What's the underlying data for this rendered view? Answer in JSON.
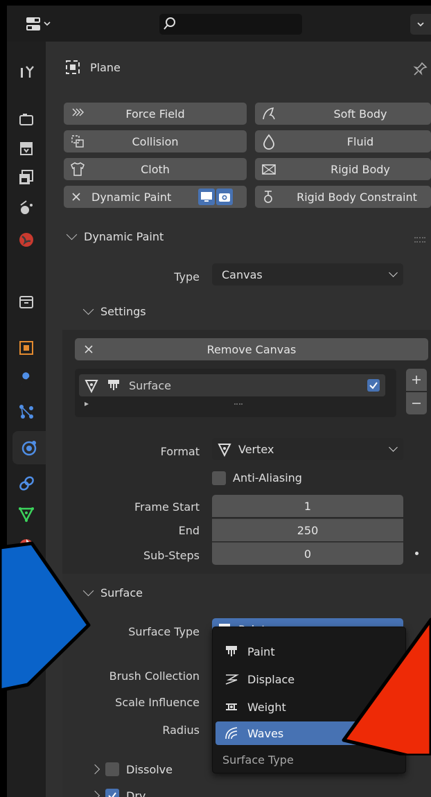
{
  "topbar": {
    "search_placeholder": ""
  },
  "object": {
    "name": "Plane"
  },
  "physics_buttons": {
    "force_field": "Force Field",
    "soft_body": "Soft Body",
    "collision": "Collision",
    "fluid": "Fluid",
    "cloth": "Cloth",
    "rigid_body": "Rigid Body",
    "dynamic_paint": "Dynamic Paint",
    "rigid_body_constraint": "Rigid Body Constraint"
  },
  "dynamic_paint": {
    "header": "Dynamic Paint",
    "type_label": "Type",
    "type_value": "Canvas",
    "settings_header": "Settings",
    "remove_canvas": "Remove Canvas",
    "surface_list_item": "Surface",
    "surface_enabled": true
  },
  "format": {
    "format_label": "Format",
    "format_value": "Vertex",
    "anti_aliasing": "Anti-Aliasing",
    "frame_start_label": "Frame Start",
    "frame_start": "1",
    "end_label": "End",
    "end": "250",
    "substeps_label": "Sub-Steps",
    "substeps": "0"
  },
  "surface": {
    "header": "Surface",
    "surface_type_label": "Surface Type",
    "surface_type_value": "Paint",
    "brush_collection_label": "Brush Collection",
    "scale_influence_label": "Scale Influence",
    "radius_label": "Radius",
    "dissolve_label": "Dissolve",
    "dry_label": "Dry"
  },
  "surface_type_menu": {
    "items": [
      "Paint",
      "Displace",
      "Weight",
      "Waves"
    ],
    "highlighted": "Waves",
    "footer": "Surface Type"
  },
  "colors": {
    "accent": "#4772b3",
    "blue_arrow": "#0a63c9",
    "red_arrow": "#ee2a06"
  }
}
